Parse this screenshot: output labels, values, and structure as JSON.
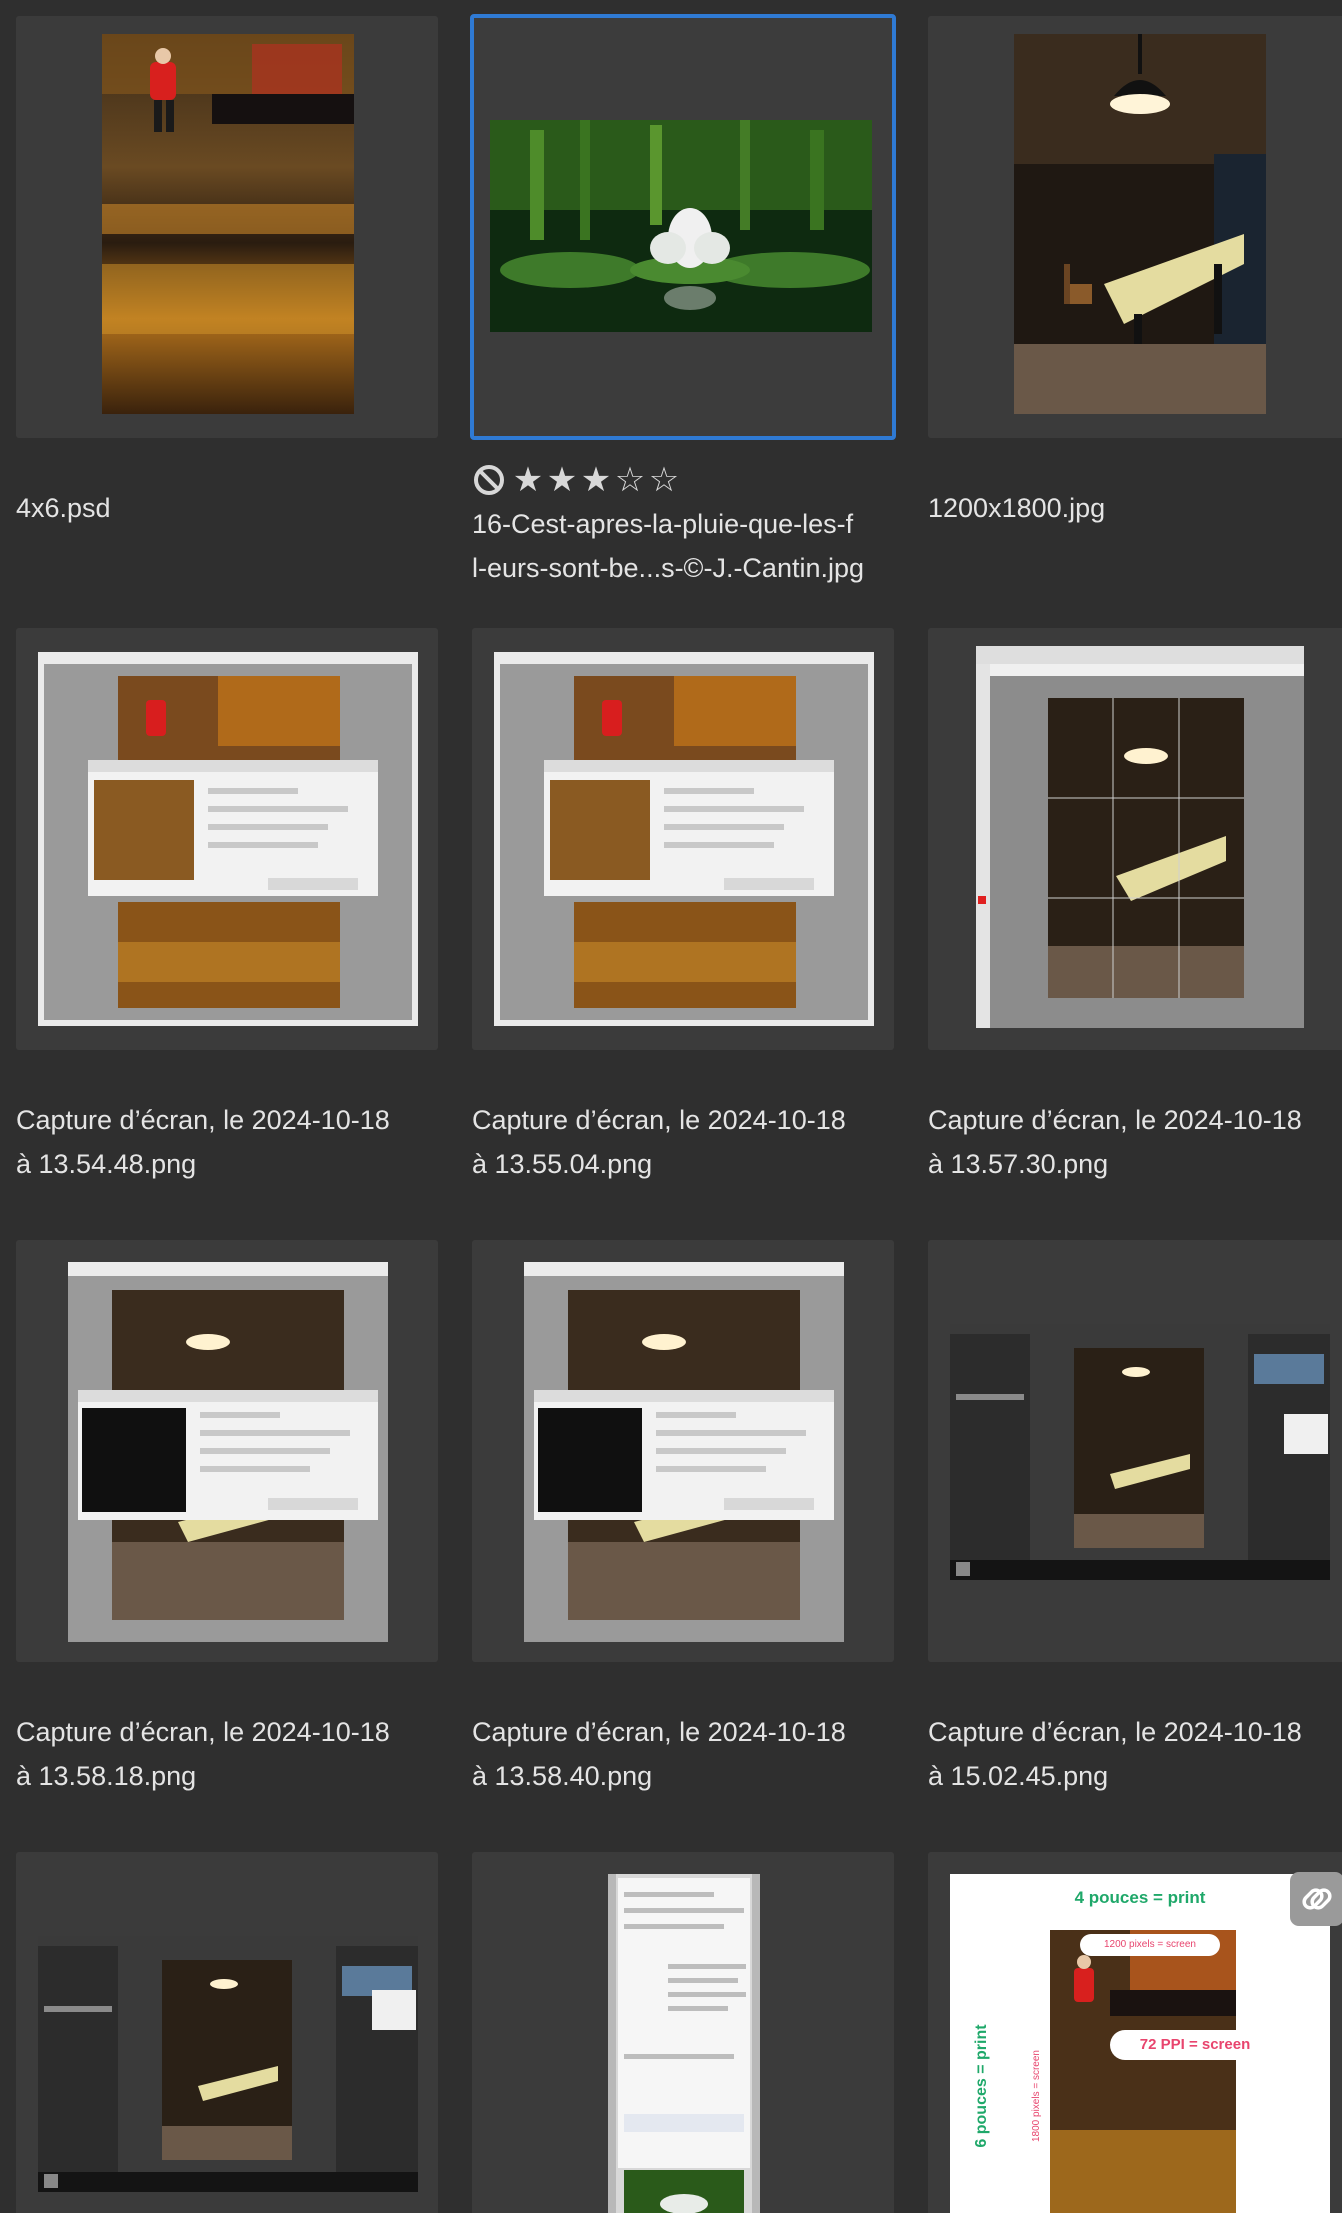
{
  "photos": [
    {
      "caption_line1": "4x6.psd",
      "caption_line2": ""
    },
    {
      "caption_line1": "16-Cest-apres-la-pluie-que-les-f",
      "caption_line2": "l-eurs-sont-be...s-©-J.-Cantin.jpg",
      "rating": 3,
      "max_rating": 5,
      "rejected_flag_icon": "reject-circle-icon",
      "selected": true
    },
    {
      "caption_line1": "1200x1800.jpg",
      "caption_line2": ""
    },
    {
      "caption_line1": "Capture d’écran, le 2024-10-18",
      "caption_line2": "à 13.54.48.png"
    },
    {
      "caption_line1": "Capture d’écran, le 2024-10-18",
      "caption_line2": "à 13.55.04.png"
    },
    {
      "caption_line1": "Capture d’écran, le 2024-10-18",
      "caption_line2": "à 13.57.30.png"
    },
    {
      "caption_line1": "Capture d’écran, le 2024-10-18",
      "caption_line2": "à 13.58.18.png"
    },
    {
      "caption_line1": "Capture d’écran, le 2024-10-18",
      "caption_line2": "à 13.58.40.png"
    },
    {
      "caption_line1": "Capture d’écran, le 2024-10-18",
      "caption_line2": "à 15.02.45.png"
    },
    {
      "caption_line1": "",
      "caption_line2": ""
    },
    {
      "caption_line1": "",
      "caption_line2": ""
    },
    {
      "caption_line1": "",
      "caption_line2": "",
      "badge_icon": "link-icon"
    }
  ],
  "infographic": {
    "top_label": "4 pouces = print",
    "side_label": "6 pouces = print",
    "px_label_top": "1200 pixels = screen",
    "ppi_label": "72 PPI = screen",
    "px_label_side": "1800 pixels = screen"
  },
  "colors": {
    "background": "#2f2f2f",
    "tile": "#3b3b3b",
    "selection": "#2f7ad4",
    "text": "#e4e4e4",
    "infographic_green": "#1fa86a",
    "infographic_pink": "#e8456e"
  }
}
